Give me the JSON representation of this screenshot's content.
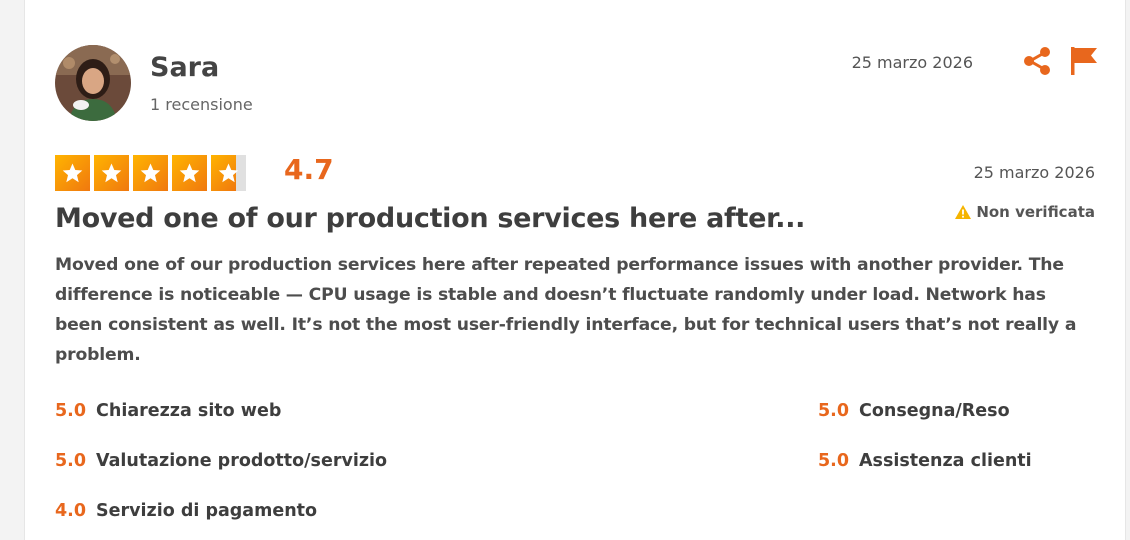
{
  "reviewer": {
    "name": "Sara",
    "review_count": "1 recensione",
    "date": "25 marzo 2026"
  },
  "actions": {
    "share_icon": "share-icon",
    "flag_icon": "flag-icon"
  },
  "review": {
    "stars": [
      1,
      1,
      1,
      1,
      0.7
    ],
    "rating": "4.7",
    "date": "25 marzo 2026",
    "verification": "Non verificata",
    "title": "Moved one of our production services here after...",
    "body": "Moved one of our production services here after repeated performance issues with another provider. The difference is noticeable — CPU usage is stable and doesn’t fluctuate randomly under load. Network has been consistent as well. It’s not the most user-friendly interface, but for technical users that’s not really a problem."
  },
  "sub_ratings": [
    {
      "score": "5.0",
      "label": "Chiarezza sito web"
    },
    {
      "score": "5.0",
      "label": "Consegna/Reso"
    },
    {
      "score": "5.0",
      "label": "Valutazione prodotto/servizio"
    },
    {
      "score": "5.0",
      "label": "Assistenza clienti"
    },
    {
      "score": "4.0",
      "label": "Servizio di pagamento"
    }
  ],
  "colors": {
    "accent": "#e8671d",
    "star_light": "#ffb400",
    "star_dark": "#f0780f",
    "warning": "#f5b400"
  }
}
